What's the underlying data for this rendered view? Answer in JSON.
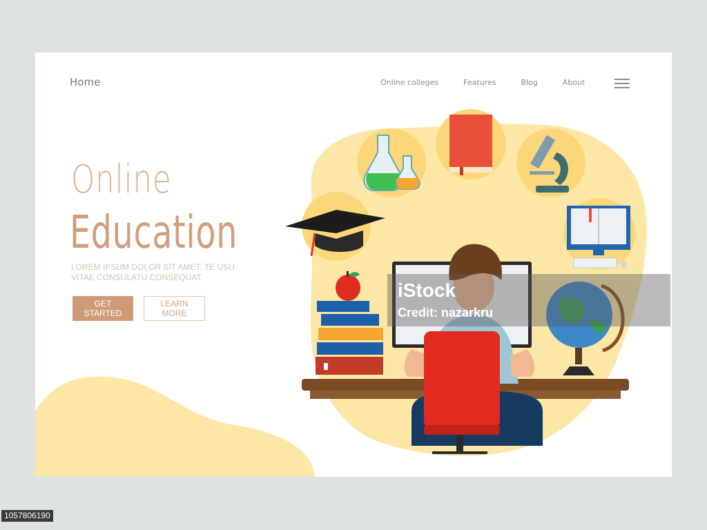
{
  "nav": {
    "home": "Home",
    "links": [
      "Online colleges",
      "Features",
      "Blog",
      "About"
    ],
    "menu_icon": "hamburger-menu-icon"
  },
  "hero": {
    "line1": "Online",
    "line2": "Education",
    "subtitle": "LOREM IPSUM DOLOR SIT AMET, TE USU VITAE CONSULATU CONSEQUAT.",
    "cta_primary": "GET STARTED",
    "cta_secondary": "LEARN MORE"
  },
  "illustration_icons": [
    "flask-icon",
    "book-icon",
    "microscope-icon",
    "graduation-cap-icon",
    "computer-icon",
    "globe-icon",
    "apple-icon",
    "book-stack-icon"
  ],
  "watermark": {
    "logo": "iStock",
    "credit": "Credit: nazarkru"
  },
  "stock_id": "1057806190",
  "colors": {
    "background": "#dce3e2",
    "accent": "#cf9a77",
    "accent_light": "#d8b496",
    "blob": "#fce7a6"
  }
}
